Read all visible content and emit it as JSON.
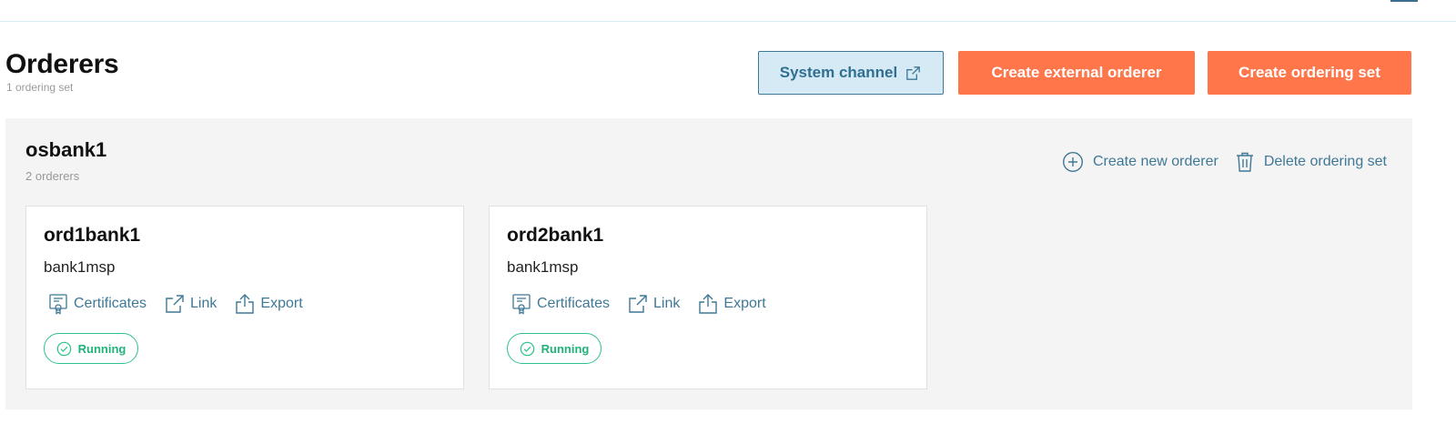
{
  "header": {
    "title": "Orderers",
    "subtitle": "1 ordering set",
    "system_channel_label": "System channel",
    "create_external_label": "Create external orderer",
    "create_set_label": "Create ordering set"
  },
  "group": {
    "name": "osbank1",
    "count": "2 orderers",
    "create_label": "Create new orderer",
    "delete_label": "Delete ordering set"
  },
  "cards": [
    {
      "name": "ord1bank1",
      "msp": "bank1msp",
      "certificates_label": "Certificates",
      "link_label": "Link",
      "export_label": "Export",
      "status": "Running"
    },
    {
      "name": "ord2bank1",
      "msp": "bank1msp",
      "certificates_label": "Certificates",
      "link_label": "Link",
      "export_label": "Export",
      "status": "Running"
    }
  ],
  "colors": {
    "accent": "#ff764a",
    "link": "#3f7896",
    "status_green": "#2ec28a",
    "system_button_bg": "#d6eaf5"
  },
  "icons": {
    "system_channel": "external-link-icon",
    "create": "plus-circle-icon",
    "delete": "trash-icon",
    "certificates": "certificate-icon",
    "link": "external-link-icon",
    "export": "export-icon",
    "status": "check-circle-icon"
  }
}
